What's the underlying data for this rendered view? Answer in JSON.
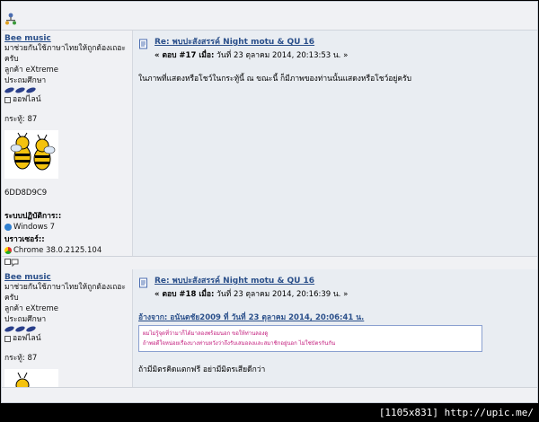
{
  "footer": {
    "caption": "[1105x831] http://upic.me/"
  },
  "posts": [
    {
      "poster": {
        "name": "Bee music",
        "tagline": "มาช่วยกันใช้ภาษาไทยให้ถูกต้องเถอะครับ",
        "rank": "ลูกค้า eXtreme",
        "level": "ประถมศึกษา",
        "status": "ออฟไลน์",
        "karma": "กระทู้: 87",
        "uid": "6DD8D9C9",
        "os_label": "ระบบปฏิบัติการ::",
        "os": "Windows 7",
        "browser_label": "บราวเซอร์::",
        "browser": "Chrome 38.0.2125.104"
      },
      "title": "Re: พบปะสังสรรค์ Night motu & QU 16",
      "meta_prefix": "« ตอบ #17 เมื่อ:",
      "meta_date": " วันที่ 23 ตุลาคม 2014, 20:13:53 น. »",
      "body": "ในภาพที่แสดงหรือโชว์ในกระทู้นี้ ณ ขณะนี้ ก็มีภาพของท่านนั้นแสดงหรือโชว์อยู่ครับ"
    },
    {
      "poster": {
        "name": "Bee music",
        "tagline": "มาช่วยกันใช้ภาษาไทยให้ถูกต้องเถอะครับ",
        "rank": "ลูกค้า eXtreme",
        "level": "ประถมศึกษา",
        "status": "ออฟไลน์",
        "karma": "กระทู้: 87"
      },
      "title": "Re: พบปะสังสรรค์ Night motu & QU 16",
      "meta_prefix": "« ตอบ #18 เมื่อ:",
      "meta_date": " วันที่ 23 ตุลาคม 2014, 20:16:39 น. »",
      "quote_head": "อ้างจาก: อนันตชัย2009 ที่ วันที่ 23 ตุลาคม  2014, 20:06:41 น.",
      "quote_lines": [
        "ผมไม่รู้จุดที่ว่ามาก็ได้มาลองพร้อมนอก ขอให้ท่านลองดู",
        "ถ้าพอดีใจหน่อยเรื่องบางท่านหวังว่าถึงรับเสมอลงและสมาชิกอยู่นอก ไม่ใช่บัตรกันกัน"
      ],
      "body": "ถ้ามีมิตรคิดแตกฟรี อย่ามีมิตรเสียดีกว่า"
    }
  ],
  "colors": {
    "link": "#2a4f8a",
    "quote_text": "#c2187a",
    "bg": "#f0f1f4"
  }
}
